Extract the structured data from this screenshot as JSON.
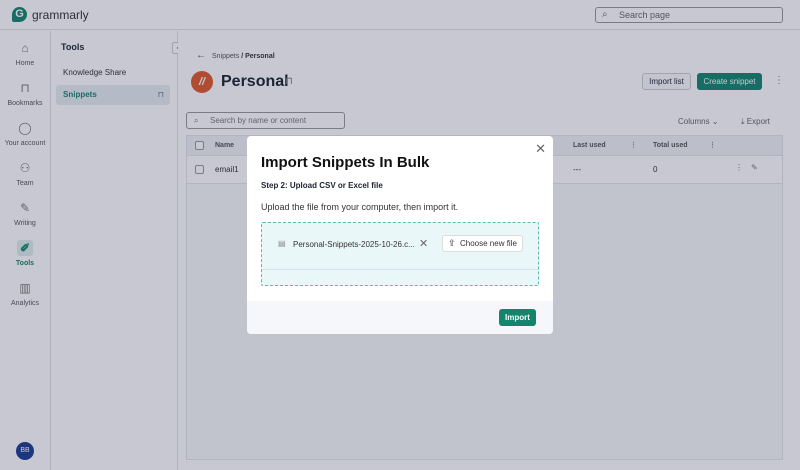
{
  "app": {
    "brand": "grammarly",
    "logo_letter": "G",
    "search_placeholder": "Search page"
  },
  "rail": {
    "items": [
      {
        "label": "Home",
        "icon": "⌂"
      },
      {
        "label": "Bookmarks",
        "icon": "⊓"
      },
      {
        "label": "Your account",
        "icon": "◯"
      },
      {
        "label": "Team",
        "icon": "⚇"
      },
      {
        "label": "Writing",
        "icon": "✎"
      },
      {
        "label": "Tools",
        "icon": "✐"
      },
      {
        "label": "Analytics",
        "icon": "▥"
      }
    ],
    "avatar": "BB"
  },
  "tools": {
    "title": "Tools",
    "items": [
      "Knowledge Share",
      "Snippets"
    ]
  },
  "main": {
    "breadcrumb_parent": "Snippets",
    "breadcrumb_sep": " / ",
    "breadcrumb_current": "Personal",
    "title": "Personal",
    "import_list": "Import list",
    "create_snippet": "Create snippet",
    "search_placeholder": "Search by name or content",
    "columns": "Columns",
    "export": "Export",
    "table": {
      "headers": {
        "name": "Name",
        "last_used": "Last used",
        "total_used": "Total used"
      },
      "rows": [
        {
          "name": "email1",
          "last_used": "---",
          "total_used": "0"
        }
      ]
    }
  },
  "modal": {
    "title": "Import Snippets In Bulk",
    "step": "Step 2: Upload CSV or Excel file",
    "description": "Upload the file from your computer, then import it.",
    "file_name": "Personal-Snippets-2025-10-26.c...",
    "choose_new_file": "Choose new file",
    "import": "Import"
  }
}
